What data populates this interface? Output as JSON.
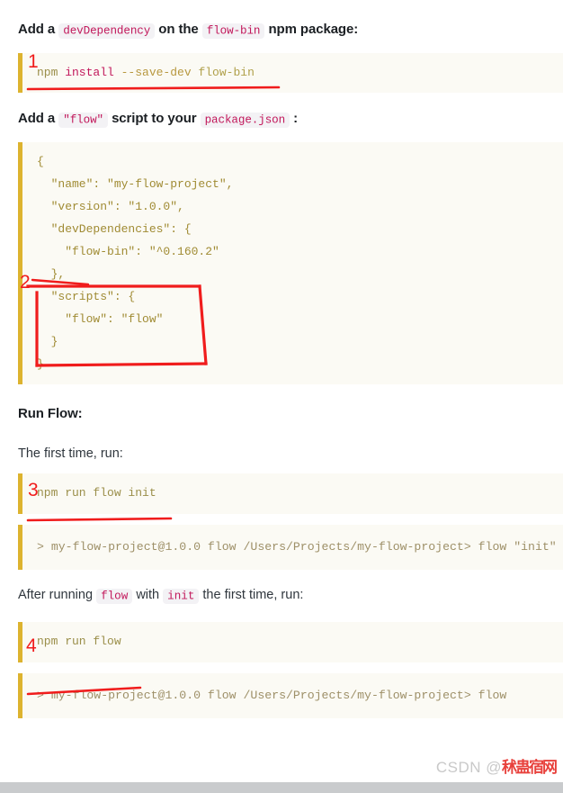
{
  "sections": {
    "intro1": {
      "prefix": "Add a ",
      "code1": "devDependency",
      "middle": " on the ",
      "code2": "flow-bin",
      "suffix": " npm package:"
    },
    "intro2": {
      "prefix": "Add a ",
      "code1": "\"flow\"",
      "middle": " script to your ",
      "code2": "package.json",
      "suffix": " :"
    },
    "run_flow_heading": "Run Flow:",
    "first_time_text": "The first time, run:",
    "after_running": {
      "prefix": "After running ",
      "code1": "flow",
      "middle": " with ",
      "code2": "init",
      "suffix": " the first time, run:"
    }
  },
  "code_install": {
    "cmd": "npm",
    "sub": " install",
    "flag": " --save-dev",
    "arg": " flow-bin"
  },
  "code_package_json": {
    "lines": [
      "{",
      "  \"name\": \"my-flow-project\",",
      "  \"version\": \"1.0.0\",",
      "  \"devDependencies\": {",
      "    \"flow-bin\": \"^0.160.2\"",
      "  },",
      "  \"scripts\": {",
      "    \"flow\": \"flow\"",
      "  }",
      "}"
    ]
  },
  "code_run_init": {
    "text": "npm run flow init"
  },
  "terminal_init": {
    "line1": "> my-flow-project@1.0.0 flow /Users/Projects/my-flow-project",
    "line2": "> flow \"init\""
  },
  "code_run_flow": {
    "text": "npm run flow"
  },
  "terminal_flow": {
    "line1": "> my-flow-project@1.0.0 flow /Users/Projects/my-flow-project",
    "line2": "> flow"
  },
  "annotations": {
    "numbers": [
      "1",
      "2",
      "3",
      "4"
    ],
    "color": "#f01c1c"
  },
  "watermark": {
    "prefix": "CSDN @",
    "handle": "秫蛊宿网"
  },
  "colors": {
    "accent_bar": "#ddb32f",
    "code_bg": "#fbfaf4",
    "chip_text": "#c2185b",
    "chip_bg": "#f3f2f5",
    "annotation_red": "#f01c1c"
  }
}
